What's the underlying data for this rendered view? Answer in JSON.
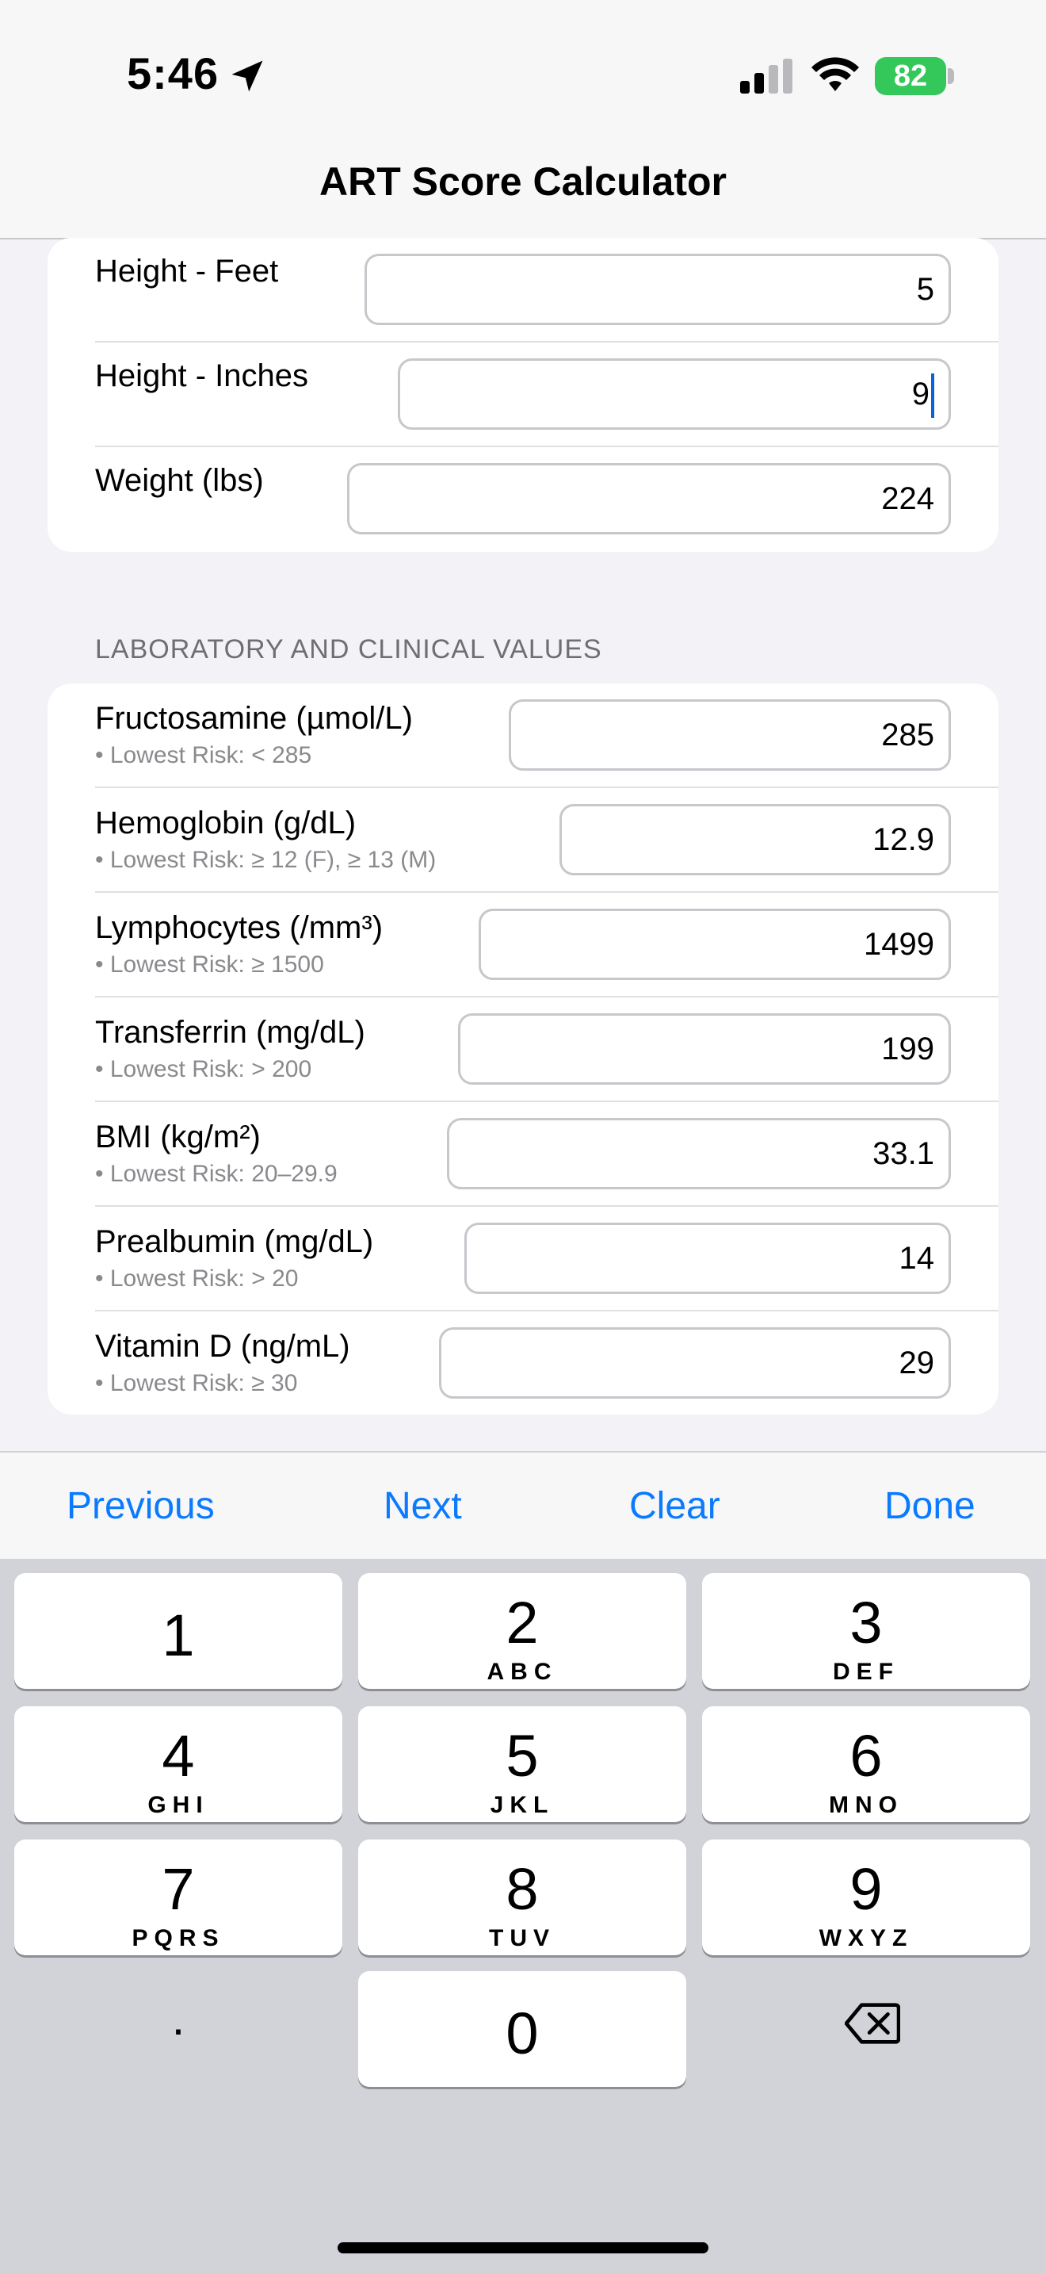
{
  "status_bar": {
    "time": "5:46",
    "battery": "82",
    "icons": [
      "location-arrow-icon",
      "signal-icon",
      "wifi-icon",
      "battery-charging-icon"
    ]
  },
  "nav": {
    "title": "ART Score Calculator"
  },
  "body_measurements": [
    {
      "label": "Height - Feet",
      "value": "5"
    },
    {
      "label": "Height - Inches",
      "value": "9"
    },
    {
      "label": "Weight (lbs)",
      "value": "224"
    }
  ],
  "lab_section": {
    "header": "LABORATORY AND CLINICAL VALUES",
    "rows": [
      {
        "label": "Fructosamine (µmol/L)",
        "hint": "• Lowest Risk: < 285",
        "value": "285"
      },
      {
        "label": "Hemoglobin (g/dL)",
        "hint": "• Lowest Risk: ≥ 12 (F), ≥ 13 (M)",
        "value": "12.9"
      },
      {
        "label": "Lymphocytes (/mm³)",
        "hint": "• Lowest Risk: ≥ 1500",
        "value": "1499"
      },
      {
        "label": "Transferrin (mg/dL)",
        "hint": "• Lowest Risk: > 200",
        "value": "199"
      },
      {
        "label": "BMI (kg/m²)",
        "hint": "• Lowest Risk: 20–29.9",
        "value": "33.1"
      },
      {
        "label": "Prealbumin (mg/dL)",
        "hint": "• Lowest Risk: > 20",
        "value": "14"
      },
      {
        "label": "Vitamin D (ng/mL)",
        "hint": "• Lowest Risk: ≥ 30",
        "value": "29"
      }
    ]
  },
  "toolbar": {
    "previous": "Previous",
    "next": "Next",
    "clear": "Clear",
    "done": "Done"
  },
  "keyboard": {
    "keys": [
      {
        "num": "1",
        "letters": ""
      },
      {
        "num": "2",
        "letters": "ABC"
      },
      {
        "num": "3",
        "letters": "DEF"
      },
      {
        "num": "4",
        "letters": "GHI"
      },
      {
        "num": "5",
        "letters": "JKL"
      },
      {
        "num": "6",
        "letters": "MNO"
      },
      {
        "num": "7",
        "letters": "PQRS"
      },
      {
        "num": "8",
        "letters": "TUV"
      },
      {
        "num": "9",
        "letters": "WXYZ"
      },
      {
        "num": "0",
        "letters": ""
      }
    ],
    "decimal": ".",
    "delete_icon": "delete-backspace-icon"
  },
  "colors": {
    "accent": "#0a7aff",
    "battery": "#34c759",
    "caret": "#0a62d9"
  }
}
